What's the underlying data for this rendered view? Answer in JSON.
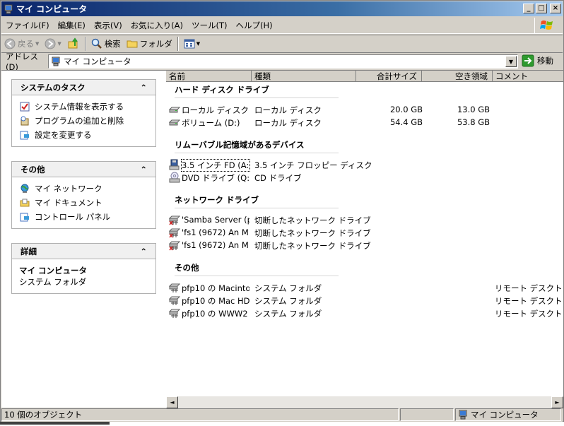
{
  "window": {
    "title": "マイ コンピュータ"
  },
  "titlebar_buttons": {
    "minimize": "_",
    "maximize": "□",
    "close": "×"
  },
  "menu": [
    "ファイル(F)",
    "編集(E)",
    "表示(V)",
    "お気に入り(A)",
    "ツール(T)",
    "ヘルプ(H)"
  ],
  "toolbar": {
    "back": "戻る",
    "search": "検索",
    "folders": "フォルダ"
  },
  "address": {
    "label": "アドレス(D)",
    "value": "マイ コンピュータ",
    "go": "移動"
  },
  "left": {
    "system_tasks": {
      "title": "システムのタスク",
      "items": [
        "システム情報を表示する",
        "プログラムの追加と削除",
        "設定を変更する"
      ]
    },
    "other_places": {
      "title": "その他",
      "items": [
        "マイ ネットワーク",
        "マイ ドキュメント",
        "コントロール パネル"
      ]
    },
    "details": {
      "title": "詳細",
      "name": "マイ コンピュータ",
      "type": "システム フォルダ"
    },
    "collapse_glyph": "⌃"
  },
  "columns": [
    "名前",
    "種類",
    "合計サイズ",
    "空き領域",
    "コメント"
  ],
  "groups": {
    "hard_disks": {
      "title": "ハード ディスク ドライブ",
      "rows": [
        {
          "name": "ローカル ディスク (...",
          "type": "ローカル ディスク",
          "total": "20.0 GB",
          "free": "13.0 GB",
          "comment": ""
        },
        {
          "name": "ボリューム (D:)",
          "type": "ローカル ディスク",
          "total": "54.4 GB",
          "free": "53.8 GB",
          "comment": ""
        }
      ]
    },
    "removable": {
      "title": "リムーバブル記憶域があるデバイス",
      "rows": [
        {
          "name": "3.5 インチ FD (A:)",
          "type": "3.5 インチ フロッピー ディスク",
          "total": "",
          "free": "",
          "comment": ""
        },
        {
          "name": "DVD ドライブ (Q:)",
          "type": "CD ドライブ",
          "total": "",
          "free": "",
          "comment": ""
        }
      ]
    },
    "network": {
      "title": "ネットワーク ドライブ",
      "rows": [
        {
          "name": "'Samba Server (p...",
          "type": "切断したネットワーク ドライブ",
          "total": "",
          "free": "",
          "comment": ""
        },
        {
          "name": "'fs1 (9672) An M...",
          "type": "切断したネットワーク ドライブ",
          "total": "",
          "free": "",
          "comment": ""
        },
        {
          "name": "'fs1 (9672) An M...",
          "type": "切断したネットワーク ドライブ",
          "total": "",
          "free": "",
          "comment": ""
        }
      ]
    },
    "other": {
      "title": "その他",
      "rows": [
        {
          "name": "pfp10 の Macinto",
          "type": "システム フォルダ",
          "total": "",
          "free": "",
          "comment": "リモート デスクトップ接"
        },
        {
          "name": "pfp10 の Mac HD",
          "type": "システム フォルダ",
          "total": "",
          "free": "",
          "comment": "リモート デスクトップ接"
        },
        {
          "name": "pfp10 の WWW2",
          "type": "システム フォルダ",
          "total": "",
          "free": "",
          "comment": "リモート デスクトップ接"
        }
      ]
    }
  },
  "scroll": {
    "left": "◄",
    "right": "►"
  },
  "status": {
    "count": "10 個のオブジェクト",
    "location": "マイ コンピュータ"
  }
}
